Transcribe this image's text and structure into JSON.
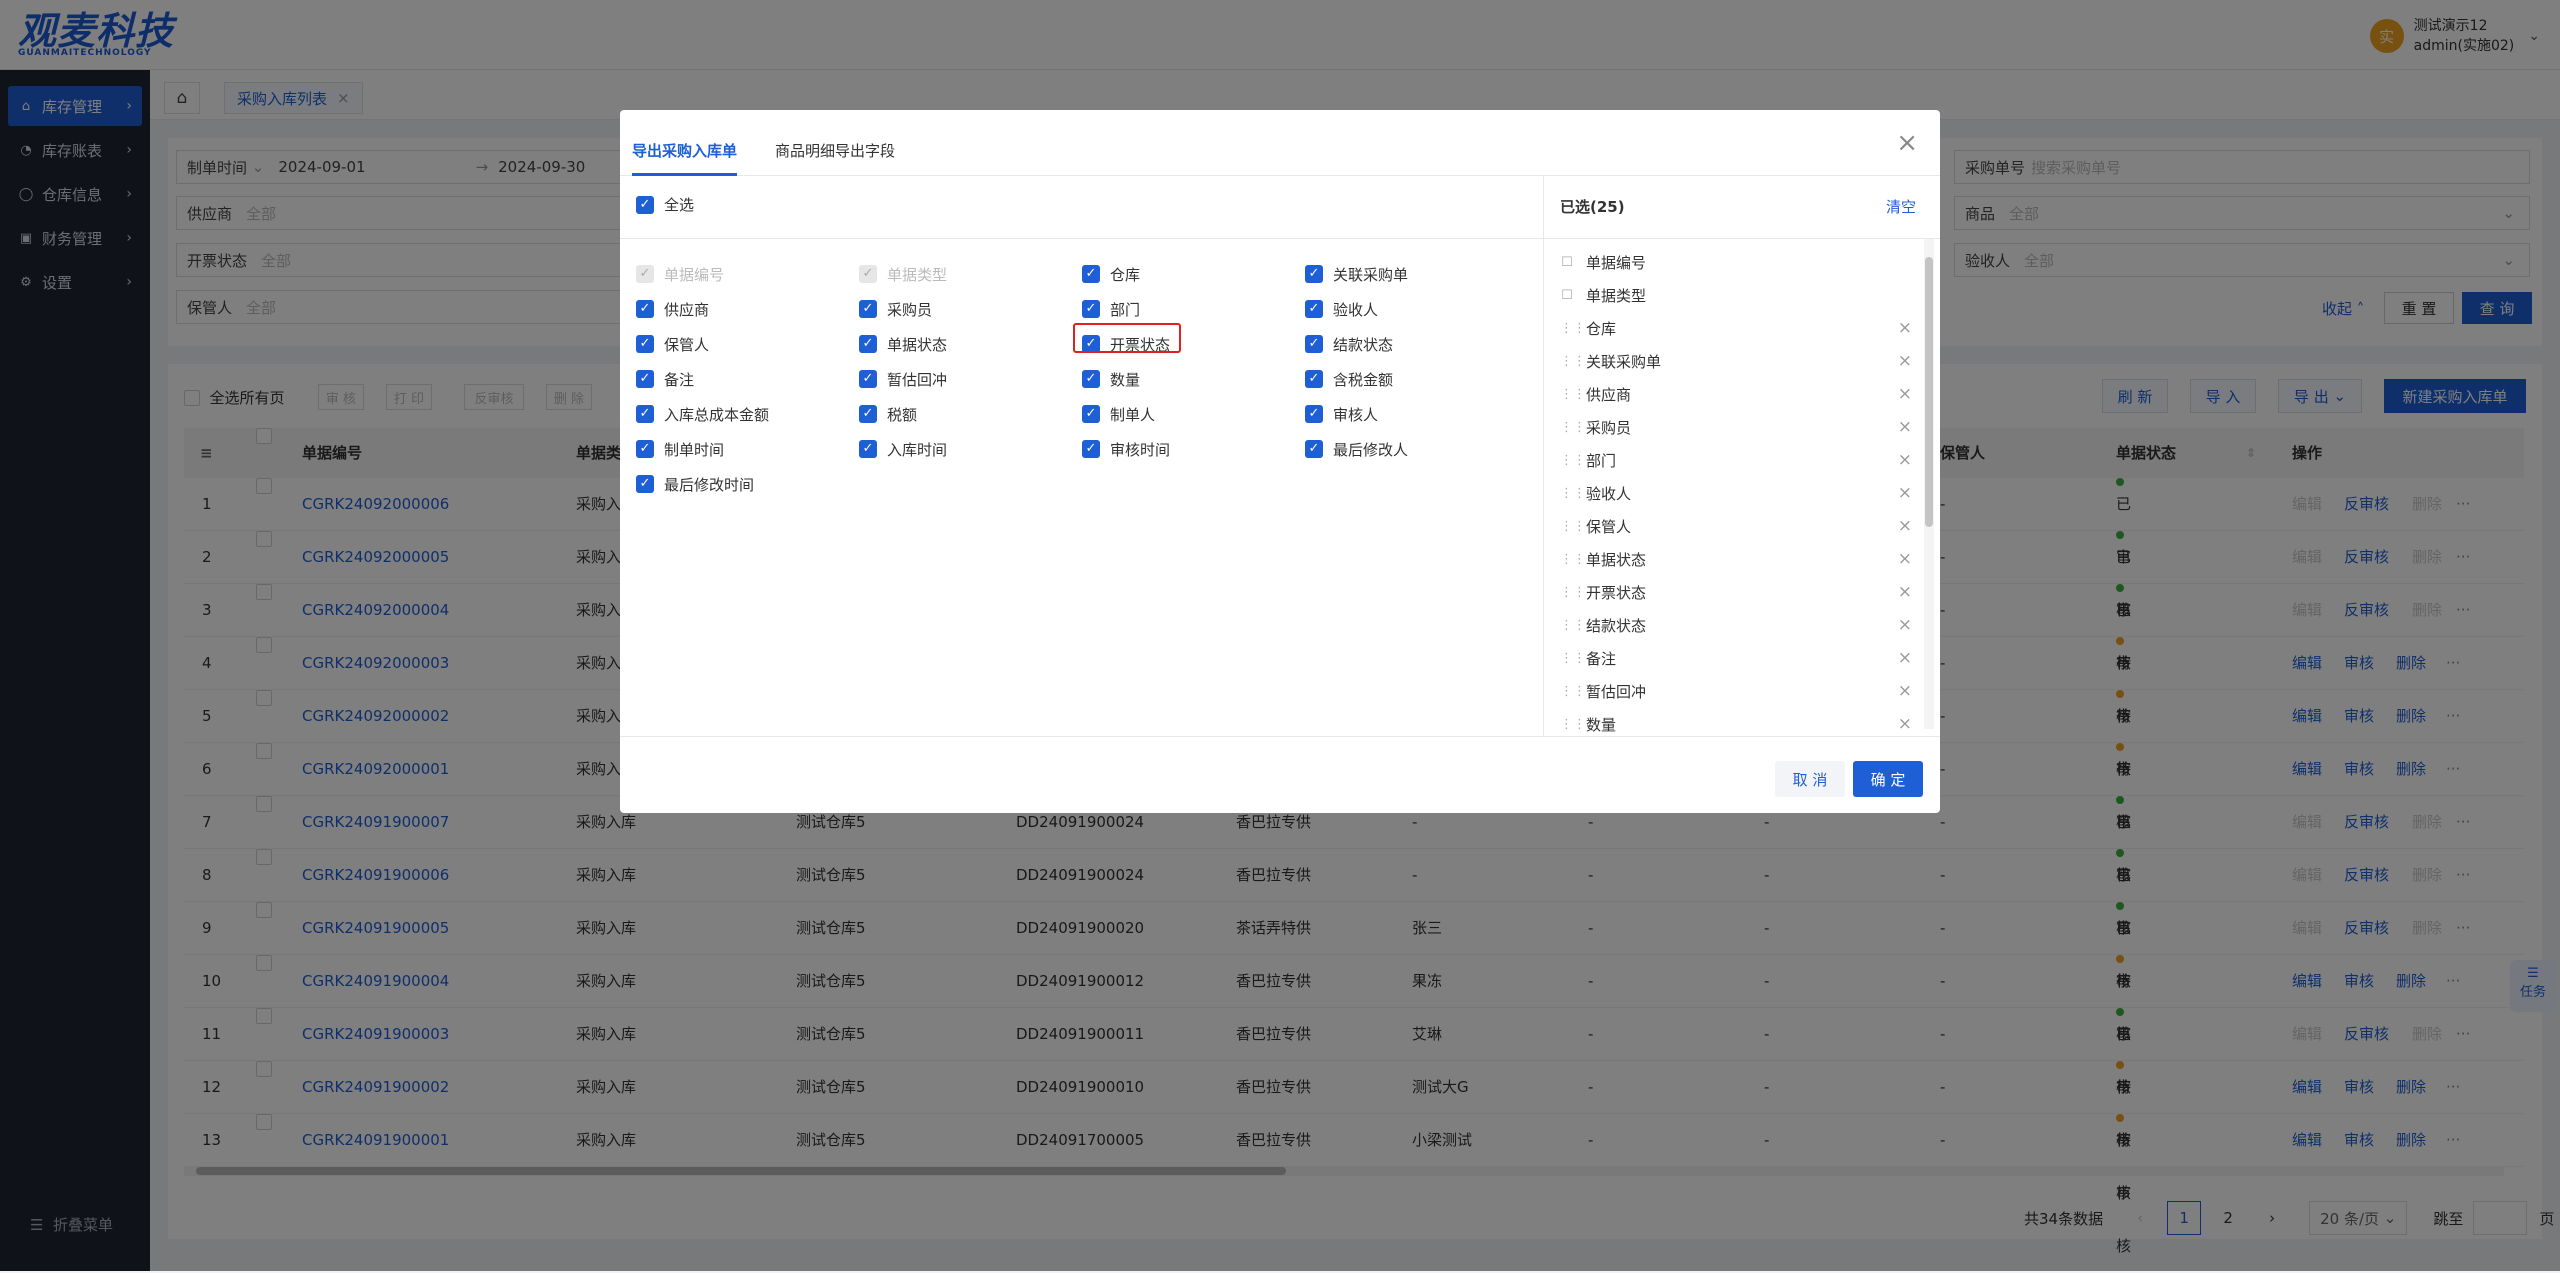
{
  "header": {
    "logo": "观麦科技",
    "logo_sub": "GUANMAITECHNOLOGY",
    "avatar": "实",
    "user_line1": "测试演示12",
    "user_line2": "admin(实施02)"
  },
  "sidebar": {
    "items": [
      {
        "label": "库存管理",
        "icon": "home-icon"
      },
      {
        "label": "库存账表",
        "icon": "chart-icon"
      },
      {
        "label": "仓库信息",
        "icon": "box-icon"
      },
      {
        "label": "财务管理",
        "icon": "wallet-icon"
      },
      {
        "label": "设置",
        "icon": "gear-icon"
      }
    ],
    "collapse": "折叠菜单"
  },
  "tabs": {
    "current": "采购入库列表"
  },
  "filters": {
    "date_type": "制单时间",
    "date_start": "2024-09-01",
    "date_sep": "→",
    "date_end": "2024-09-30",
    "supplier": "供应商",
    "invoice": "开票状态",
    "keeper": "保管人",
    "all": "全部",
    "order_no": "采购单号",
    "order_ph": "搜索采购单号",
    "product": "商品",
    "receiver": "验收人",
    "collapse": "收起",
    "reset": "重 置",
    "query": "查 询"
  },
  "toolbar": {
    "select_all_pages": "全选所有页",
    "audit": "审 核",
    "print": "打 印",
    "unaudit": "反审核",
    "delete": "删 除",
    "refresh": "刷 新",
    "import": "导 入",
    "export": "导 出",
    "new": "新建采购入库单"
  },
  "table": {
    "headers": {
      "no": "单据编号",
      "type": "单据类",
      "keeper": "保管人",
      "status": "单据状态",
      "action": "操作"
    },
    "rows": [
      {
        "idx": "1",
        "no": "CGRK24092000006",
        "type": "采购入",
        "wh": "",
        "po": "",
        "sup": "",
        "rcv": "",
        "keeper": "-",
        "status": "已审核",
        "done": true
      },
      {
        "idx": "2",
        "no": "CGRK24092000005",
        "type": "采购入",
        "wh": "",
        "po": "",
        "sup": "",
        "rcv": "",
        "keeper": "-",
        "status": "已审核",
        "done": true
      },
      {
        "idx": "3",
        "no": "CGRK24092000004",
        "type": "采购入",
        "wh": "",
        "po": "",
        "sup": "",
        "rcv": "",
        "keeper": "-",
        "status": "已审核",
        "done": true
      },
      {
        "idx": "4",
        "no": "CGRK24092000003",
        "type": "采购入",
        "wh": "",
        "po": "",
        "sup": "",
        "rcv": "",
        "keeper": "-",
        "status": "待审核",
        "done": false
      },
      {
        "idx": "5",
        "no": "CGRK24092000002",
        "type": "采购入",
        "wh": "",
        "po": "",
        "sup": "",
        "rcv": "",
        "keeper": "-",
        "status": "待审核",
        "done": false
      },
      {
        "idx": "6",
        "no": "CGRK24092000001",
        "type": "采购入",
        "wh": "",
        "po": "",
        "sup": "",
        "rcv": "",
        "keeper": "-",
        "status": "待审核",
        "done": false
      },
      {
        "idx": "7",
        "no": "CGRK24091900007",
        "type": "采购入库",
        "wh": "测试仓库5",
        "po": "DD24091900024",
        "sup": "香巴拉专供",
        "rcv": "-",
        "keeper": "-",
        "status": "已审核",
        "done": true
      },
      {
        "idx": "8",
        "no": "CGRK24091900006",
        "type": "采购入库",
        "wh": "测试仓库5",
        "po": "DD24091900024",
        "sup": "香巴拉专供",
        "rcv": "-",
        "keeper": "-",
        "status": "已审核",
        "done": true
      },
      {
        "idx": "9",
        "no": "CGRK24091900005",
        "type": "采购入库",
        "wh": "测试仓库5",
        "po": "DD24091900020",
        "sup": "茶话弄特供",
        "rcv": "张三",
        "keeper": "-",
        "status": "已审核",
        "done": true
      },
      {
        "idx": "10",
        "no": "CGRK24091900004",
        "type": "采购入库",
        "wh": "测试仓库5",
        "po": "DD24091900012",
        "sup": "香巴拉专供",
        "rcv": "果冻",
        "keeper": "-",
        "status": "待审核",
        "done": false
      },
      {
        "idx": "11",
        "no": "CGRK24091900003",
        "type": "采购入库",
        "wh": "测试仓库5",
        "po": "DD24091900011",
        "sup": "香巴拉专供",
        "rcv": "艾琳",
        "keeper": "-",
        "status": "已审核",
        "done": true
      },
      {
        "idx": "12",
        "no": "CGRK24091900002",
        "type": "采购入库",
        "wh": "测试仓库5",
        "po": "DD24091900010",
        "sup": "香巴拉专供",
        "rcv": "测试大G",
        "keeper": "-",
        "status": "待审核",
        "done": false
      },
      {
        "idx": "13",
        "no": "CGRK24091900001",
        "type": "采购入库",
        "wh": "测试仓库5",
        "po": "DD24091700005",
        "sup": "香巴拉专供",
        "rcv": "小梁测试",
        "keeper": "-",
        "status": "待审核",
        "done": false
      }
    ],
    "actions": {
      "edit": "编辑",
      "unaudit": "反审核",
      "audit": "审核",
      "delete": "删除",
      "more": "···"
    }
  },
  "pager": {
    "total": "共34条数据",
    "p1": "1",
    "p2": "2",
    "size": "20 条/页",
    "jump": "跳至",
    "page": "页"
  },
  "task": "任务",
  "modal": {
    "tab1": "导出采购入库单",
    "tab2": "商品明细导出字段",
    "select_all": "全选",
    "fields": [
      [
        "单据编号",
        "单据类型",
        "仓库",
        "关联采购单"
      ],
      [
        "供应商",
        "采购员",
        "部门",
        "验收人"
      ],
      [
        "保管人",
        "单据状态",
        "开票状态",
        "结款状态"
      ],
      [
        "备注",
        "暂估回冲",
        "数量",
        "含税金额"
      ],
      [
        "入库总成本金额",
        "税额",
        "制单人",
        "审核人"
      ],
      [
        "制单时间",
        "入库时间",
        "审核时间",
        "最后修改人"
      ],
      [
        "最后修改时间"
      ]
    ],
    "selected_title": "已选(25)",
    "clear": "清空",
    "selected": [
      "单据编号",
      "单据类型",
      "仓库",
      "关联采购单",
      "供应商",
      "采购员",
      "部门",
      "验收人",
      "保管人",
      "单据状态",
      "开票状态",
      "结款状态",
      "备注",
      "暂估回冲",
      "数量"
    ],
    "cancel": "取 消",
    "ok": "确 定"
  },
  "colors": {
    "primary": "#1f5fd6",
    "success": "#3cb043",
    "warning": "#f0a020",
    "highlight": "#e02020"
  }
}
